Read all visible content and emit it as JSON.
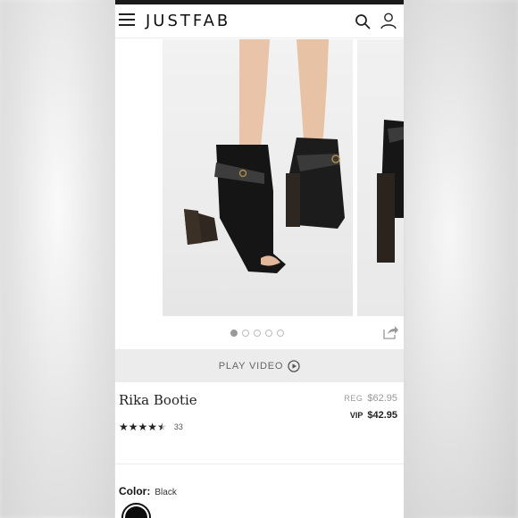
{
  "header": {
    "brand": "JUSTFAB",
    "menu_icon": "hamburger-menu-icon",
    "search_icon": "search-icon",
    "account_icon": "user-account-icon"
  },
  "carousel": {
    "dot_count": 5,
    "active_index": 0,
    "share_icon": "share-icon"
  },
  "video": {
    "label": "PLAY VIDEO",
    "icon": "play-circle-icon"
  },
  "product": {
    "name": "Rika Bootie",
    "reg_label": "REG",
    "reg_price": "$62.95",
    "vip_label": "VIP",
    "vip_price": "$42.95",
    "rating": 4.5,
    "review_count": "33"
  },
  "color": {
    "label": "Color:",
    "value": "Black",
    "swatch_hex": "#0d0d0d"
  },
  "colors": {
    "brand_text": "#111111",
    "top_bar": "#1a1a1a",
    "video_bar": "#ececec"
  }
}
